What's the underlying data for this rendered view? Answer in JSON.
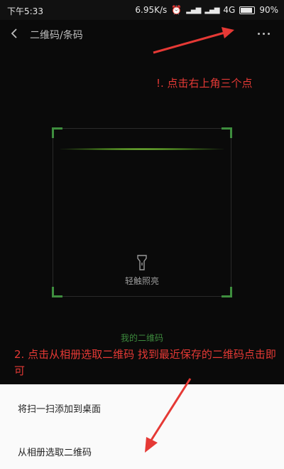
{
  "status_bar": {
    "time": "下午5:33",
    "speed": "6.95K/s",
    "network": "4G",
    "battery": "90%"
  },
  "app_bar": {
    "title": "二维码/条码",
    "back_icon": "chevron-left-icon",
    "more_icon": "more-horizontal-icon"
  },
  "annotations": {
    "step1": "!. 点击右上角三个点",
    "step2": "2. 点击从相册选取二维码 找到最近保存的二维码点击即可"
  },
  "scanner": {
    "flash_label": "轻触照亮",
    "flash_icon": "flashlight-icon",
    "my_qr_label": "我的二维码",
    "accent": "#3e8e3e"
  },
  "sheet": {
    "items": [
      "将扫一扫添加到桌面",
      "从相册选取二维码"
    ]
  },
  "colors": {
    "annotation": "#e53935",
    "background": "#0a0a0a"
  }
}
